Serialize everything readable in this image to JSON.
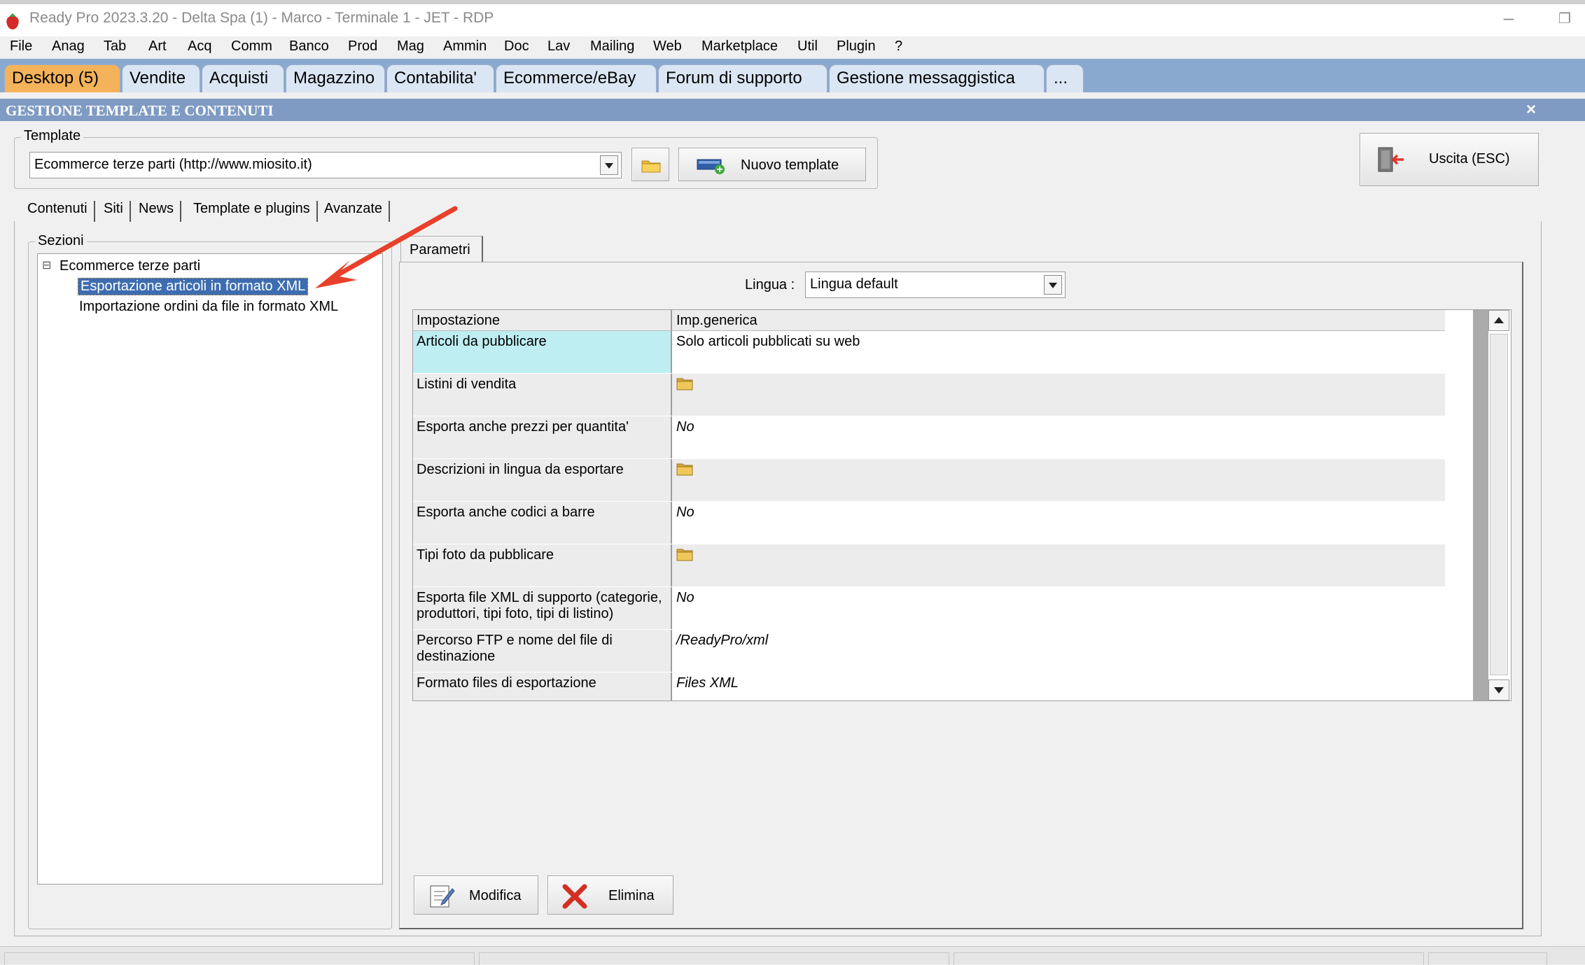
{
  "window": {
    "title": "Ready Pro 2023.3.20 - Delta Spa (1) - Marco - Terminale 1 - JET - RDP"
  },
  "menu": [
    "File",
    "Anag",
    "Tab",
    "Art",
    "Acq",
    "Comm",
    "Banco",
    "Prod",
    "Mag",
    "Ammin",
    "Doc",
    "Lav",
    "Mailing",
    "Web",
    "Marketplace",
    "Util",
    "Plugin",
    "?"
  ],
  "module_tabs": [
    "Desktop (5)",
    "Vendite",
    "Acquisti",
    "Magazzino",
    "Contabilita'",
    "Ecommerce/eBay",
    "Forum di supporto",
    "Gestione messaggistica",
    "..."
  ],
  "panel": {
    "title": "GESTIONE TEMPLATE E CONTENUTI",
    "close": "×"
  },
  "template": {
    "group_label": "Template",
    "selected": "Ecommerce terze parti (http://www.miosito.it)",
    "new_button": "Nuovo template",
    "exit_button": "Uscita (ESC)"
  },
  "subtabs": [
    "Contenuti",
    "Siti",
    "News",
    "Template e plugins",
    "Avanzate"
  ],
  "sections": {
    "group_label": "Sezioni",
    "root": "Ecommerce terze parti",
    "expander": "⊟",
    "items": [
      "Esportazione articoli in formato XML",
      "Importazione ordini da file in formato XML"
    ]
  },
  "params": {
    "tab_label": "Parametri",
    "language_label": "Lingua :",
    "language_value": "Lingua default",
    "columns": [
      "Impostazione",
      "Imp.generica"
    ],
    "rows": [
      {
        "key": "Articoli da pubblicare",
        "value": "Solo articoli pubblicati su web"
      },
      {
        "key": "Listini di vendita",
        "value": "",
        "icon": "folder-icon"
      },
      {
        "key": "Esporta anche prezzi per quantita'",
        "value": "No"
      },
      {
        "key": "Descrizioni in lingua da esportare",
        "value": "",
        "icon": "folder-icon"
      },
      {
        "key": "Esporta anche codici a barre",
        "value": "No"
      },
      {
        "key": "Tipi foto da pubblicare",
        "value": "",
        "icon": "folder-icon"
      },
      {
        "key": "Esporta file XML di supporto (categorie, produttori, tipi foto, tipi di listino)",
        "value": "No"
      },
      {
        "key": "Percorso FTP e nome del file di destinazione",
        "value": "/ReadyPro/xml"
      },
      {
        "key": "Formato files di esportazione",
        "value": "Files XML"
      }
    ],
    "edit_button": "Modifica",
    "delete_button": "Elimina"
  },
  "colors": {
    "tabbar": "#8aa9cf",
    "active_tab": "#f4b35a",
    "header": "#7f9bc3",
    "selection": "#3d6db0",
    "selected_key": "#bfeef2",
    "arrow": "#e8402a"
  }
}
